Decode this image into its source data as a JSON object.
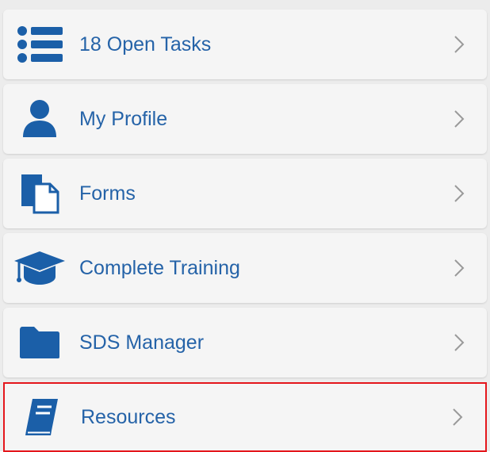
{
  "menu": {
    "items": [
      {
        "label": "18 Open Tasks",
        "icon": "list-icon"
      },
      {
        "label": "My Profile",
        "icon": "user-icon"
      },
      {
        "label": "Forms",
        "icon": "forms-icon"
      },
      {
        "label": "Complete Training",
        "icon": "graduation-cap-icon"
      },
      {
        "label": "SDS Manager",
        "icon": "folder-icon"
      },
      {
        "label": "Resources",
        "icon": "book-icon"
      }
    ]
  },
  "colors": {
    "accent": "#1b5fa8",
    "label": "#2563a8",
    "highlight_border": "#e4161c",
    "chevron": "#9a9a9a"
  }
}
